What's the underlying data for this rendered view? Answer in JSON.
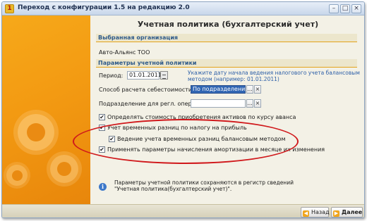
{
  "window": {
    "title": "Переход с конфигурации 1.5 на редакцию 2.0",
    "minimize": "–",
    "maximize": "□",
    "close": "×"
  },
  "page": {
    "heading": "Учетная политика (бухгалтерский учет)"
  },
  "org_section": {
    "title": "Выбранная организация",
    "name": "Авто-Альянс ТОО"
  },
  "policy_section": {
    "title": "Параметры учетной политики"
  },
  "period": {
    "label": "Период:",
    "value": "01.01.2011",
    "hint": "Укажите дату начала ведения налогового учета балансовым методом (например: 01.01.2011)"
  },
  "cost_method": {
    "label": "Способ расчета себестоимости:",
    "value": "По подразделениям",
    "choose": "...",
    "clear": "×"
  },
  "department": {
    "label": "Подразделение для регл. опер.:",
    "value": "",
    "choose": "...",
    "clear": "×"
  },
  "checkboxes": [
    {
      "label": "Определять стоимость приобретения активов по курсу аванса",
      "checked": true
    },
    {
      "label": "Учет временных разниц по налогу на прибыль",
      "checked": true
    },
    {
      "label": "Ведение учета временных разниц балансовым методом",
      "checked": true
    },
    {
      "label": "Применять параметры начисления амортизации в месяце их изменения",
      "checked": true
    }
  ],
  "checkmark": "✔",
  "info": {
    "icon": "i",
    "text": "Параметры учетной политики сохраняются в регистр сведений \"Учетная политика(бухгалтерский учет)\"."
  },
  "nav": {
    "back_arrow": "◀",
    "back": "Назад",
    "next_arrow": "▶",
    "next": "Далее"
  },
  "icons": {
    "app": "1c-logo-icon",
    "calendar": "calendar-icon",
    "info": "info-icon",
    "back": "arrow-left-icon",
    "next": "arrow-right-icon"
  },
  "colors": {
    "accent_panel": "#f39a12",
    "selection": "#3166b3",
    "highlight_ellipse": "#d0181b",
    "section_title": "#2e5a8a",
    "hint_text": "#2d5fa8"
  }
}
